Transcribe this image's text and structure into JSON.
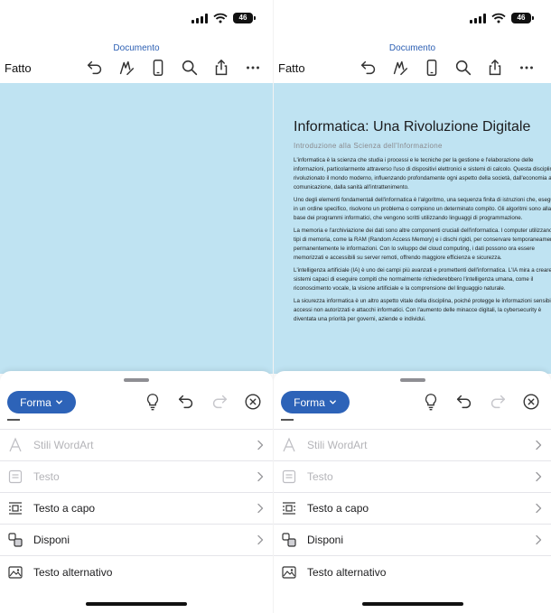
{
  "status": {
    "battery": "46"
  },
  "toolbar": {
    "doc_label": "Documento",
    "done_label": "Fatto"
  },
  "sheet": {
    "forma_label": "Forma",
    "menu": [
      {
        "label": "Stili WordArt",
        "icon": "wordart-icon",
        "disabled": true
      },
      {
        "label": "Testo",
        "icon": "text-box-icon",
        "disabled": true
      },
      {
        "label": "Testo a capo",
        "icon": "text-wrap-icon",
        "disabled": false
      },
      {
        "label": "Disponi",
        "icon": "arrange-icon",
        "disabled": false
      },
      {
        "label": "Testo alternativo",
        "icon": "alt-text-icon",
        "disabled": false
      }
    ]
  },
  "document": {
    "title": "Informatica: Una Rivoluzione Digitale",
    "subtitle": "Introduzione alla Scienza dell'Informazione",
    "paragraphs": [
      "L'informatica è la scienza che studia i processi e le tecniche per la gestione e l'elaborazione delle informazioni, particolarmente attraverso l'uso di dispositivi elettronici e sistemi di calcolo. Questa disciplina ha rivoluzionato il mondo moderno, influenzando profondamente ogni aspetto della società, dall'economia alla comunicazione, dalla sanità all'intrattenimento.",
      "Uno degli elementi fondamentali dell'informatica è l'algoritmo, una sequenza finita di istruzioni che, eseguite in un ordine specifico, risolvono un problema o compiono un determinato compito. Gli algoritmi sono alla base dei programmi informatici, che vengono scritti utilizzando linguaggi di programmazione.",
      "La memoria e l'archiviazione dei dati sono altre componenti cruciali dell'informatica. I computer utilizzano vari tipi di memoria, come la RAM (Random Access Memory) e i dischi rigidi, per conservare temporaneamente o permanentemente le informazioni. Con lo sviluppo del cloud computing, i dati possono ora essere memorizzati e accessibili su server remoti, offrendo maggiore efficienza e sicurezza.",
      "L'intelligenza artificiale (IA) è uno dei campi più avanzati e promettenti dell'informatica. L'IA mira a creare sistemi capaci di eseguire compiti che normalmente richiederebbero l'intelligenza umana, come il riconoscimento vocale, la visione artificiale e la comprensione del linguaggio naturale.",
      "La sicurezza informatica è un altro aspetto vitale della disciplina, poiché protegge le informazioni sensibili da accessi non autorizzati e attacchi informatici. Con l'aumento delle minacce digitali, la cybersecurity è diventata una priorità per governi, aziende e individui."
    ]
  },
  "colors": {
    "accent": "#2d63b8",
    "canvas": "#bfe3f2"
  }
}
